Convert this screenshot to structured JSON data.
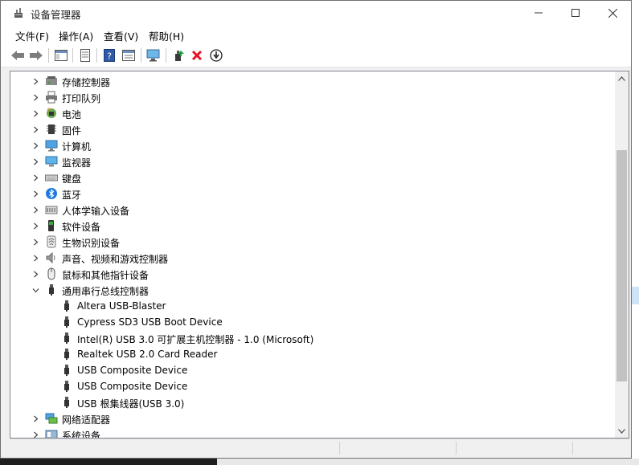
{
  "window": {
    "title": "设备管理器"
  },
  "menubar": {
    "items": [
      {
        "label": "文件(F)"
      },
      {
        "label": "操作(A)"
      },
      {
        "label": "查看(V)"
      },
      {
        "label": "帮助(H)"
      }
    ]
  },
  "toolbar": {
    "buttons": [
      "back-arrow-icon",
      "forward-arrow-icon",
      "show-hide-console-tree-icon",
      "properties-icon",
      "help-icon",
      "view-icon",
      "scan-hardware-icon",
      "update-driver-icon",
      "uninstall-icon",
      "disable-download-icon"
    ]
  },
  "tree": {
    "items": [
      {
        "label": "存储控制器",
        "icon": "storage-controller-icon",
        "expanded": false,
        "level": 0
      },
      {
        "label": "打印队列",
        "icon": "printer-icon",
        "expanded": false,
        "level": 0
      },
      {
        "label": "电池",
        "icon": "battery-icon",
        "expanded": false,
        "level": 0
      },
      {
        "label": "固件",
        "icon": "firmware-icon",
        "expanded": false,
        "level": 0
      },
      {
        "label": "计算机",
        "icon": "computer-icon",
        "expanded": false,
        "level": 0
      },
      {
        "label": "监视器",
        "icon": "monitor-icon",
        "expanded": false,
        "level": 0
      },
      {
        "label": "键盘",
        "icon": "keyboard-icon",
        "expanded": false,
        "level": 0
      },
      {
        "label": "蓝牙",
        "icon": "bluetooth-icon",
        "expanded": false,
        "level": 0
      },
      {
        "label": "人体学输入设备",
        "icon": "hid-icon",
        "expanded": false,
        "level": 0
      },
      {
        "label": "软件设备",
        "icon": "software-device-icon",
        "expanded": false,
        "level": 0
      },
      {
        "label": "生物识别设备",
        "icon": "biometric-icon",
        "expanded": false,
        "level": 0
      },
      {
        "label": "声音、视频和游戏控制器",
        "icon": "speaker-icon",
        "expanded": false,
        "level": 0
      },
      {
        "label": "鼠标和其他指针设备",
        "icon": "mouse-icon",
        "expanded": false,
        "level": 0
      },
      {
        "label": "通用串行总线控制器",
        "icon": "usb-controller-icon",
        "expanded": true,
        "level": 0
      },
      {
        "label": "Altera USB-Blaster",
        "icon": "usb-device-icon",
        "level": 1
      },
      {
        "label": "Cypress SD3 USB Boot Device",
        "icon": "usb-device-icon",
        "level": 1
      },
      {
        "label": "Intel(R) USB 3.0 可扩展主机控制器 - 1.0 (Microsoft)",
        "icon": "usb-device-icon",
        "level": 1
      },
      {
        "label": "Realtek USB 2.0 Card Reader",
        "icon": "usb-device-icon",
        "level": 1
      },
      {
        "label": "USB Composite Device",
        "icon": "usb-device-icon",
        "level": 1
      },
      {
        "label": "USB Composite Device",
        "icon": "usb-device-icon",
        "level": 1
      },
      {
        "label": "USB 根集线器(USB 3.0)",
        "icon": "usb-device-icon",
        "level": 1
      },
      {
        "label": "网络适配器",
        "icon": "network-adapter-icon",
        "expanded": false,
        "level": 0
      },
      {
        "label": "系统设备",
        "icon": "system-device-icon",
        "expanded": false,
        "level": 0
      }
    ]
  },
  "colors": {
    "selection": "#cce8ff",
    "accent": "#0078d7",
    "delete_red": "#e81123"
  }
}
